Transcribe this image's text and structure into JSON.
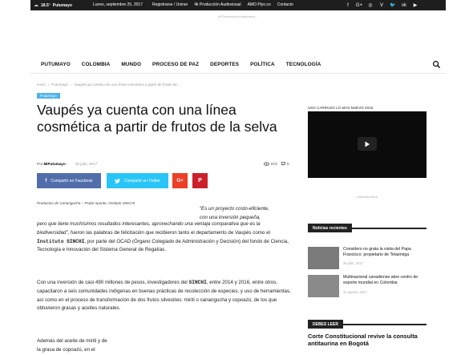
{
  "topbar": {
    "temperature": "18.5",
    "temp_unit": "°",
    "city": "Putumayo",
    "date": "Lunes, septiembre 25, 2017",
    "links": [
      "Registrarse / Unirse",
      "4k Producción Audiovisual",
      "AMO Plyo.co",
      "Contacto"
    ],
    "social_icons": [
      "facebook-icon",
      "google-plus-icon",
      "instagram-icon",
      "vimeo-icon",
      "twitter-icon",
      "vk-icon",
      "youtube-icon"
    ]
  },
  "ad_top": "- 4k Producción Audiovisual -",
  "nav": {
    "items": [
      "PUTUMAYO",
      "COLOMBIA",
      "MUNDO",
      "PROCESO DE PAZ",
      "DEPORTES",
      "POLÍTICA",
      "TECNOLOGÍA"
    ]
  },
  "breadcrumb": {
    "items": [
      "Inicio",
      "›",
      "Putumayo",
      "›",
      "Vaupés ya cuenta con una línea cosmética a partir de frutos de..."
    ]
  },
  "article": {
    "category": "Putumayo",
    "title": "Vaupés ya cuenta con una línea cosmética a partir de frutos de la selva",
    "by_label": "Por",
    "author": "MiPutumayo",
    "separator": "-",
    "date": "26 julio, 2017",
    "views": "673",
    "comments": "0",
    "share_facebook": "Compartir en Facebook",
    "share_twitter": "Compartir en Twitter",
    "caption": "Productos de Canangucha – Psala Aponte, Instituto SINCHI",
    "quote_line1": "“Es un proyecto costo-eficiente,",
    "quote_line2": "con una inversión pequeña,",
    "quote_line3": "pero que tiene muchísimos resultados interesantes, aprovechando una ventaja comparativa",
    "quote_line4": "que es la biodiversidad”",
    "p1_after_quote": ", fueron las palabras de felicitación que recibieron tanto el departamento de Vaupés como el",
    "p1_bold": "Instituto SINCHI",
    "p1_rest": ", por parte del OCAD (Órgano Colegiado de Administración y Decisión) del fondo de Ciencia, Tecnología e Innovación del Sistema General de Regalías.",
    "p2_start": "Con una inversión de casi 490 millones de pesos, investigadores del",
    "p2_bold": "SINCHI",
    "p2_rest": ", entre 2014 y 2016, entre otros, capacitaron a seis comunidades indígenas en buenas prácticas de recolección de especies, y uso de herramientas, así como en el proceso de transformación de dos frutos silvestres: miriti o canangucha y copoazú, de los que obtuvieron grasas y aceites naturales.",
    "p3_line1": "Además del aceite de miriti y de",
    "p3_line2": "la grasa de copoazú, en el"
  },
  "sidebar": {
    "video_label": "USO CARRUSO LO MAS NUEVO 2016",
    "ad_label": "- Advertisement -",
    "block1_title": "Noticias recientes",
    "news": [
      {
        "title": "Considero no grata la visita del Papa Francisco: propietario de Telaemiga",
        "date": "26 julio, 2017"
      },
      {
        "title": "Multinacional canadiense abre centro de soporte mundial en Colombia",
        "date": "11 agosto, 2017"
      }
    ],
    "block2_title": "DEBES LEER",
    "feature_title": "Corte Constitucional revive la consulta antitaurina en Bogotá"
  },
  "colors": {
    "facebook": "#516eab",
    "twitter": "#29c5f6",
    "google_plus": "#eb4026",
    "pinterest": "#ca212a",
    "category": "#4db2ec",
    "topbar": "#1e1e1e"
  }
}
